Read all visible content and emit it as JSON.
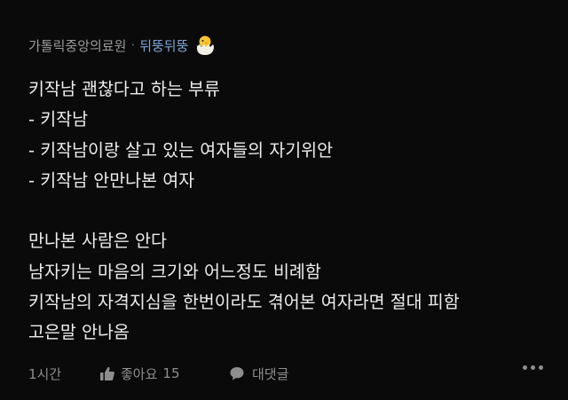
{
  "header": {
    "author_org": "가톨릭중앙의료원",
    "separator": "·",
    "author_name": "뒤뚱뒤뚱",
    "avatar_icon": "hatching-chick-icon"
  },
  "post": {
    "lines": [
      "키작남 괜찮다고 하는 부류",
      "- 키작남",
      "- 키작남이랑 살고 있는 여자들의 자기위안",
      "- 키작남 안만나본 여자",
      "",
      "만나본 사람은 안다",
      "남자키는 마음의 크기와 어느정도 비례함",
      "키작남의 자격지심을 한번이라도 겪어본 여자라면 절대 피함",
      "고은말 안나옴"
    ]
  },
  "footer": {
    "time": "1시간",
    "like_label": "좋아요",
    "like_count": "15",
    "reply_label": "대댓글",
    "more_icon": "more-dots-icon"
  },
  "colors": {
    "background": "#0a0a0a",
    "text": "#ececec",
    "muted": "#8e8e8e",
    "author_accent": "#7ea6d8"
  }
}
